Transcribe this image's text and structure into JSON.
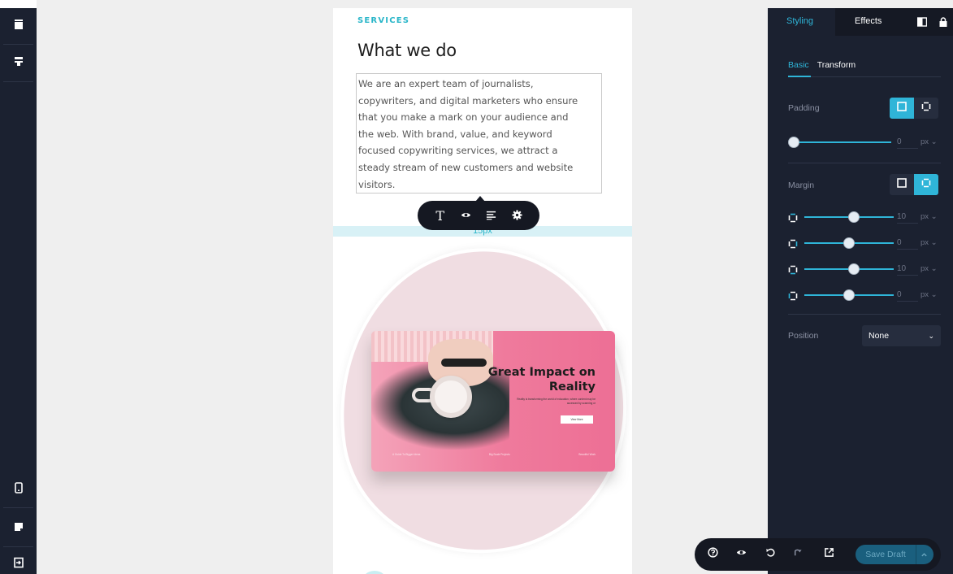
{
  "left_rail": {
    "icons": [
      "panel-top-icon",
      "component-icon",
      "mobile-device-icon",
      "page-icon",
      "exit-icon"
    ]
  },
  "canvas": {
    "section_label": "SERVICES",
    "title": "What we do",
    "body": "We are an expert team of journalists, copywriters, and digital marketers who ensure that you make a mark on your audience and the web. With brand, value, and keyword focused copywriting services, we attract a steady stream of new customers and website visitors.",
    "body_lines": [
      "We are an expert team of journalists,",
      "copywriters, and digital marketers who ensure",
      "that you make a mark on your audience and",
      "the web. With brand, value, and keyword",
      "focused copywriting services, we attract a",
      "steady stream of new customers and website",
      "visitors."
    ],
    "spacing_label": "15px",
    "text_toolbar": {
      "text_glyph": "T",
      "buttons": [
        "text-icon",
        "eye-icon",
        "align-icon",
        "gear-icon"
      ]
    },
    "hero": {
      "title": "Great Impact on Reality",
      "subtitle": "Reality is transforming the world of education, where content may be accessed by scanning or",
      "button": "View More",
      "footer_items": [
        "A Guide To Bigger Ideas",
        "Big Scale Projects",
        "Beautiful Work"
      ]
    }
  },
  "panel": {
    "tabs": [
      "Styling",
      "Effects"
    ],
    "active_tab": "Styling",
    "subtabs": [
      "Basic",
      "Transform"
    ],
    "active_subtab": "Basic",
    "padding": {
      "label": "Padding",
      "mode": "all",
      "value": "0",
      "unit": "px",
      "slider_fraction": 0.0
    },
    "margin": {
      "label": "Margin",
      "mode": "individual",
      "sides": [
        {
          "side": "top",
          "value": "10",
          "unit": "px",
          "slider_fraction": 0.55
        },
        {
          "side": "right",
          "value": "0",
          "unit": "px",
          "slider_fraction": 0.5
        },
        {
          "side": "bottom",
          "value": "10",
          "unit": "px",
          "slider_fraction": 0.55
        },
        {
          "side": "left",
          "value": "0",
          "unit": "px",
          "slider_fraction": 0.5
        }
      ]
    },
    "position": {
      "label": "Position",
      "value": "None"
    }
  },
  "bottom_bar": {
    "icons": [
      "help-icon",
      "preview-eye-icon",
      "undo-icon",
      "redo-icon",
      "external-link-icon"
    ],
    "save_label": "Save Draft"
  },
  "colors": {
    "accent": "#2fb5d8",
    "panel_bg": "#1b2130",
    "hero_pink": "#ef7a9c",
    "blob_pink": "#f0dde2"
  }
}
